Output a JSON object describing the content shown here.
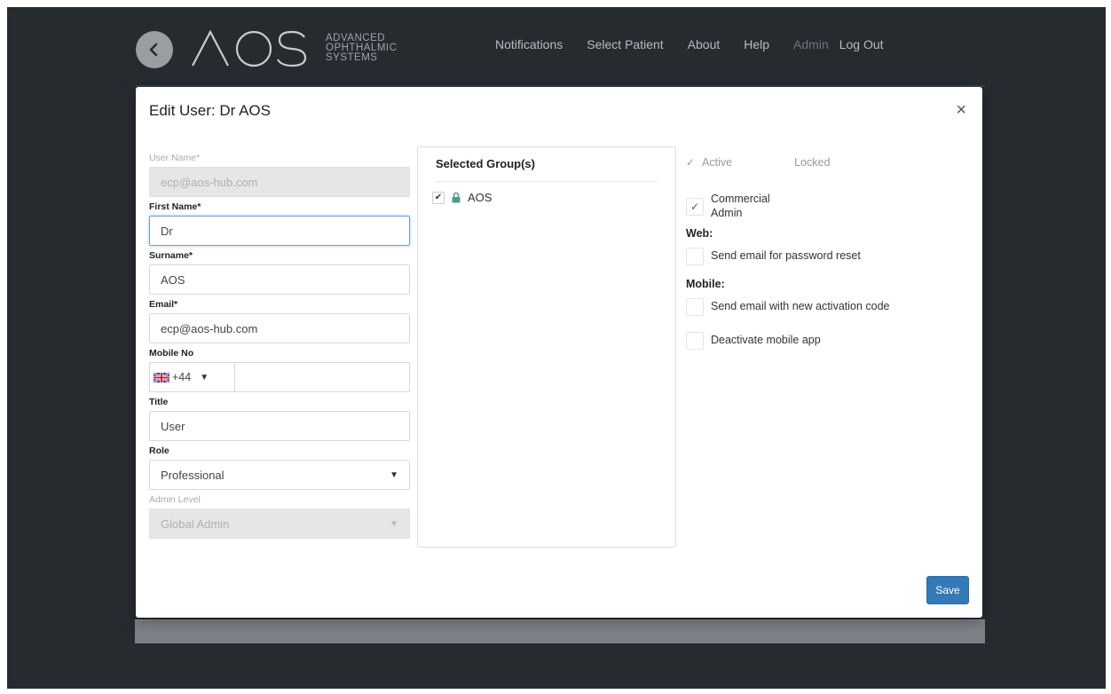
{
  "nav": {
    "logo_name": "AOS",
    "logo_tagline": [
      "ADVANCED",
      "OPHTHALMIC",
      "SYSTEMS"
    ],
    "items": [
      "Notifications",
      "Select Patient",
      "About",
      "Help",
      "Admin",
      "Log Out"
    ]
  },
  "modal": {
    "title": "Edit User: Dr AOS",
    "close": "×",
    "fields": {
      "username_label": "User Name*",
      "username_value": "ecp@aos-hub.com",
      "firstname_label": "First Name*",
      "firstname_value": "Dr",
      "surname_label": "Surname*",
      "surname_value": "AOS",
      "email_label": "Email*",
      "email_value": "ecp@aos-hub.com",
      "mobile_label": "Mobile No",
      "mobile_code": "+44",
      "mobile_value": "",
      "title_label": "Title",
      "title_value": "User",
      "role_label": "Role",
      "role_value": "Professional",
      "admin_level_label": "Admin Level",
      "admin_level_value": "Global Admin"
    },
    "groups": {
      "heading": "Selected Group(s)",
      "items": [
        {
          "label": "AOS",
          "checked": true
        }
      ]
    },
    "status": {
      "active_label": "Active",
      "locked_label": "Locked",
      "commercial_admin_label": "Commercial Admin",
      "web_heading": "Web:",
      "web_reset_label": "Send email for password reset",
      "mobile_heading": "Mobile:",
      "mobile_activation_label": "Send email with new activation code",
      "mobile_deactivate_label": "Deactivate mobile app"
    },
    "save_label": "Save"
  },
  "colors": {
    "background": "#262b30",
    "primary_button": "#337ab7",
    "lock_icon": "#4a9e8a"
  }
}
